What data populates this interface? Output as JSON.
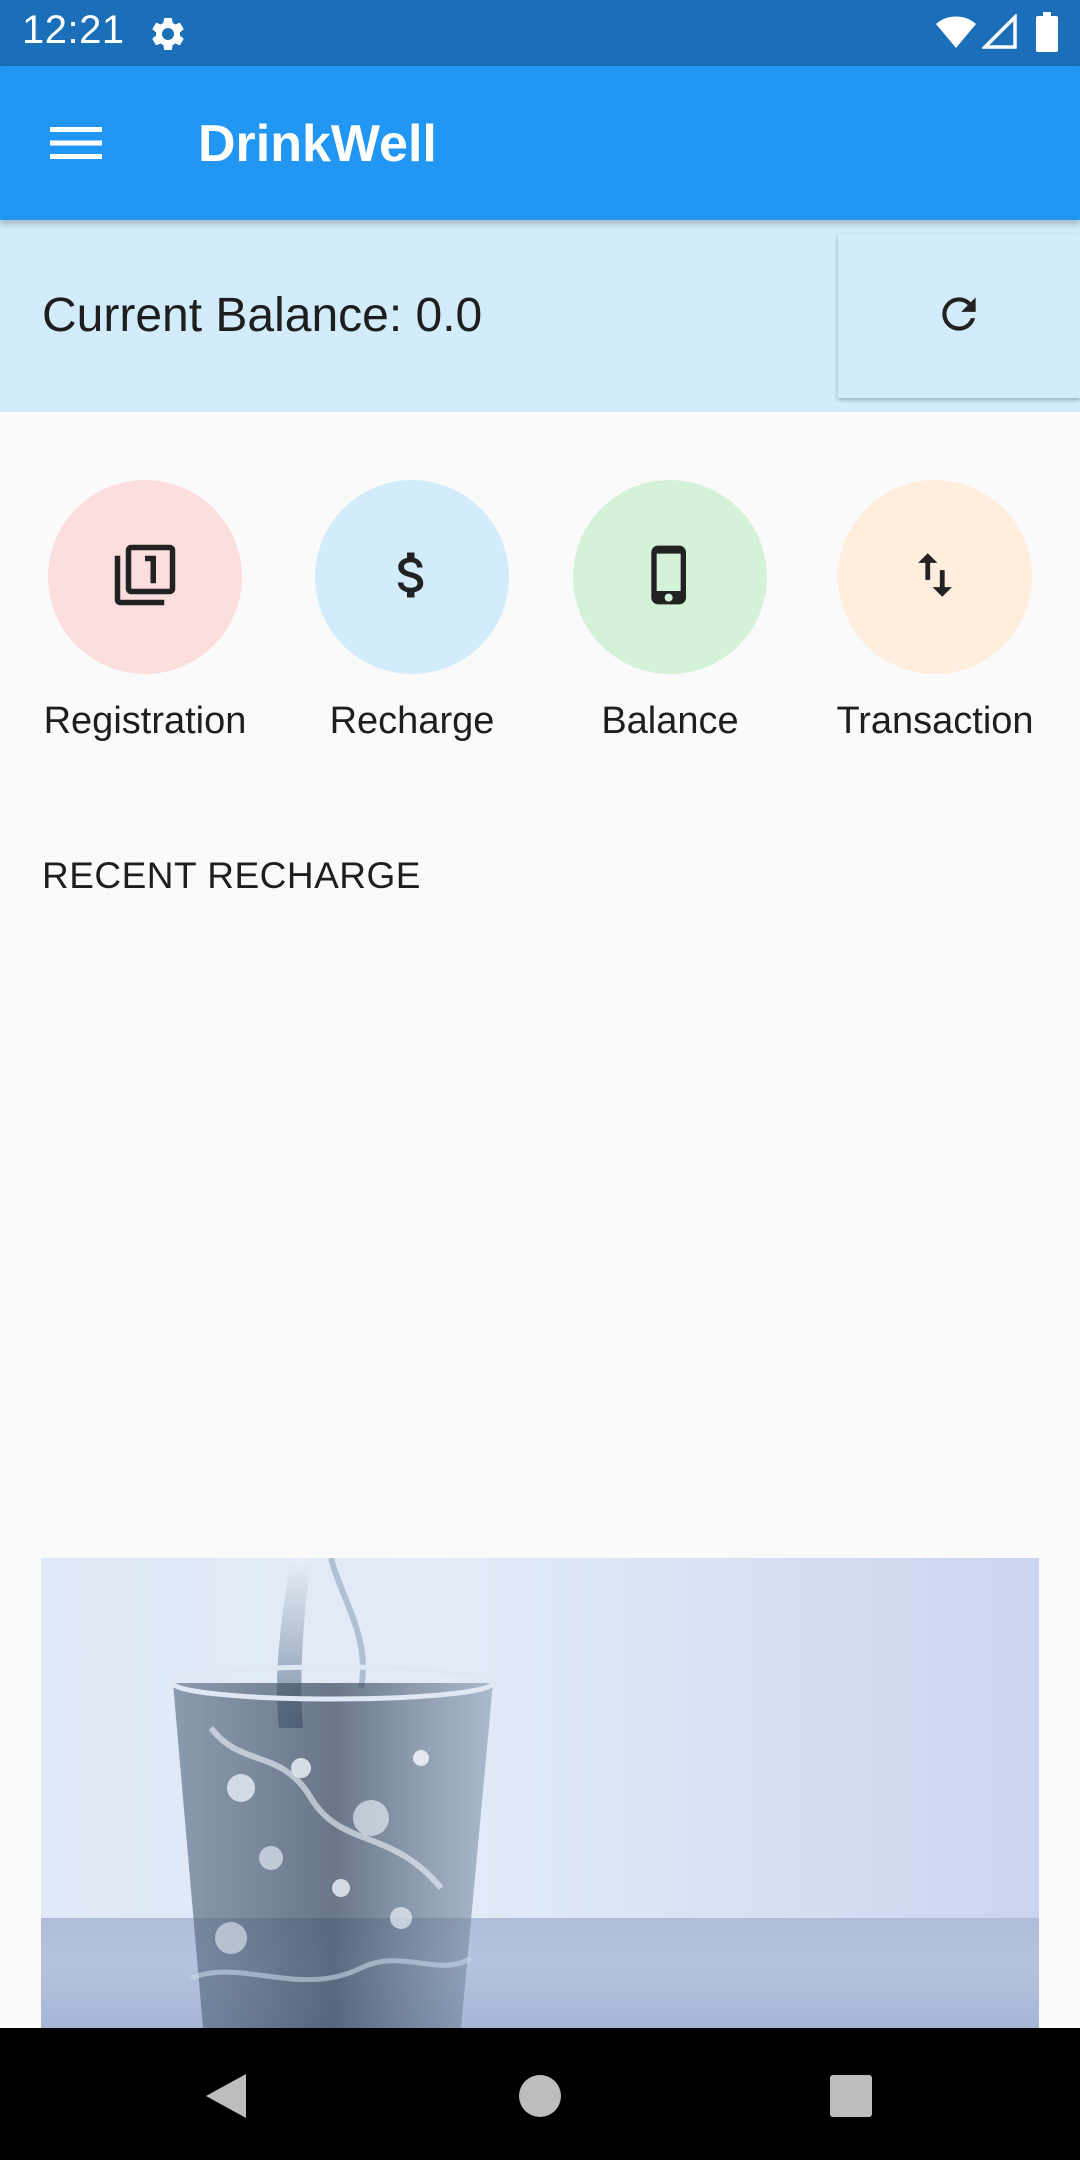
{
  "status_bar": {
    "time": "12:21",
    "icons": [
      "gear-icon",
      "wifi-icon",
      "signal-icon",
      "battery-icon"
    ]
  },
  "app_bar": {
    "title": "DrinkWell",
    "menu_icon": "menu-icon"
  },
  "balance": {
    "text": "Current Balance: 0.0",
    "refresh_icon": "refresh-icon"
  },
  "actions": [
    {
      "label": "Registration",
      "icon": "filter-1-icon",
      "color": "#fddede"
    },
    {
      "label": "Recharge",
      "icon": "dollar-icon",
      "color": "#d2ecfb"
    },
    {
      "label": "Balance",
      "icon": "phone-icon",
      "color": "#d3f2d8"
    },
    {
      "label": "Transaction",
      "icon": "swap-vert-icon",
      "color": "#ffeedd"
    }
  ],
  "recent": {
    "title": "RECENT RECHARGE"
  },
  "colors": {
    "status_bar": "#1a6fb8",
    "app_bar": "#2196f3",
    "balance_band": "#d2ecfb"
  }
}
